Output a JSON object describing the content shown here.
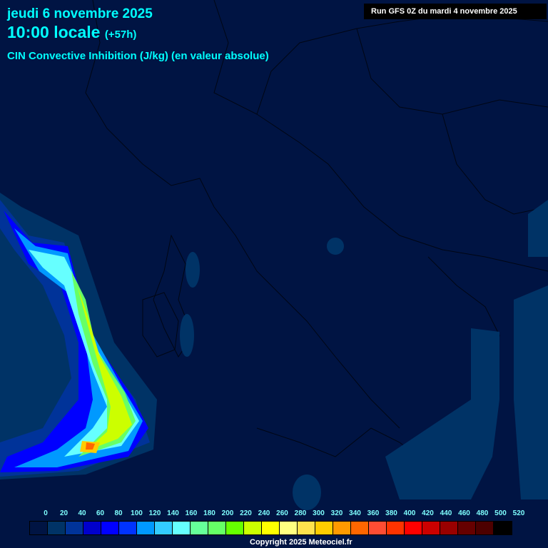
{
  "header": {
    "date": "jeudi 6 novembre 2025",
    "time": "10:00 locale",
    "lead": "(+57h)",
    "parameter": "CIN Convective Inhibition (J/kg) (en valeur absolue)",
    "run": "Run GFS 0Z du mardi 4 novembre 2025"
  },
  "legend": {
    "labels": [
      "0",
      "20",
      "40",
      "60",
      "80",
      "100",
      "120",
      "140",
      "160",
      "180",
      "200",
      "220",
      "240",
      "260",
      "280",
      "300",
      "320",
      "340",
      "360",
      "380",
      "400",
      "420",
      "440",
      "460",
      "480",
      "500",
      "520"
    ],
    "colors": [
      "#001443",
      "#003366",
      "#003399",
      "#0000cc",
      "#0000ff",
      "#0033ff",
      "#0099ff",
      "#33ccff",
      "#66ffff",
      "#66ff99",
      "#66ff66",
      "#66ff00",
      "#ccff00",
      "#ffff00",
      "#ffff80",
      "#ffe24d",
      "#ffcc00",
      "#ff9900",
      "#ff6600",
      "#ff4d33",
      "#ff3300",
      "#ff0000",
      "#cc0000",
      "#990000",
      "#660000",
      "#4d0000",
      "#000000"
    ]
  },
  "footer": {
    "copyright": "Copyright 2025 Meteociel.fr"
  }
}
